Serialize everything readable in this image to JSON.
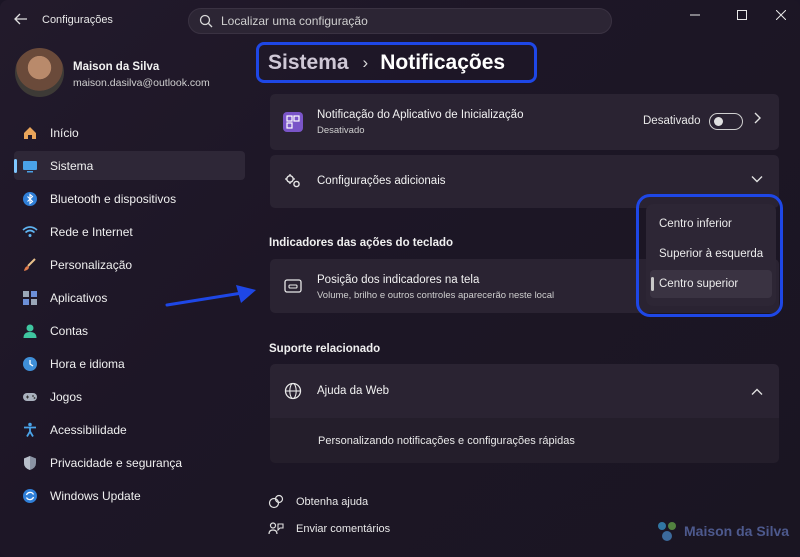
{
  "window": {
    "app_title": "Configurações",
    "search_placeholder": "Localizar uma configuração"
  },
  "user": {
    "name": "Maison da Silva",
    "email": "maison.dasilva@outlook.com"
  },
  "sidebar": {
    "items": [
      {
        "label": "Início",
        "icon": "home-icon"
      },
      {
        "label": "Sistema",
        "icon": "system-icon",
        "active": true
      },
      {
        "label": "Bluetooth e dispositivos",
        "icon": "bluetooth-icon"
      },
      {
        "label": "Rede e Internet",
        "icon": "network-icon"
      },
      {
        "label": "Personalização",
        "icon": "brush-icon"
      },
      {
        "label": "Aplicativos",
        "icon": "apps-icon"
      },
      {
        "label": "Contas",
        "icon": "account-icon"
      },
      {
        "label": "Hora e idioma",
        "icon": "globe-clock-icon"
      },
      {
        "label": "Jogos",
        "icon": "gamepad-icon"
      },
      {
        "label": "Acessibilidade",
        "icon": "accessibility-icon"
      },
      {
        "label": "Privacidade e segurança",
        "icon": "shield-icon"
      },
      {
        "label": "Windows Update",
        "icon": "update-icon"
      }
    ]
  },
  "breadcrumb": {
    "parent": "Sistema",
    "separator": "›",
    "current": "Notificações"
  },
  "startup_notification": {
    "title": "Notificação do Aplicativo de Inicialização",
    "subtitle": "Desativado",
    "status": "Desativado"
  },
  "additional_settings": {
    "title": "Configurações adicionais"
  },
  "keyboard_indicators": {
    "heading": "Indicadores das ações do teclado",
    "title": "Posição dos indicadores na tela",
    "subtitle": "Volume, brilho e outros controles aparecerão neste local"
  },
  "dropdown": {
    "options": [
      "Centro inferior",
      "Superior à esquerda",
      "Centro superior"
    ],
    "selected": "Centro superior"
  },
  "related_support": {
    "heading": "Suporte relacionado",
    "web_help": "Ajuda da Web",
    "web_help_link": "Personalizando notificações e configurações rápidas"
  },
  "footer_links": {
    "get_help": "Obtenha ajuda",
    "feedback": "Enviar comentários"
  },
  "watermark": {
    "text": "Maison da Silva"
  },
  "colors": {
    "highlight_ring": "#1e47e6",
    "accent": "#7fc7ff"
  }
}
